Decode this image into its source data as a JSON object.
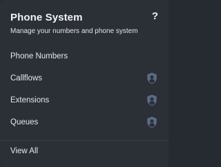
{
  "header": {
    "title": "Phone System",
    "subtitle": "Manage your numbers and phone system",
    "help_label": "?"
  },
  "menu": {
    "items": [
      {
        "label": "Phone Numbers",
        "icon": ""
      },
      {
        "label": "Callflows",
        "icon": "admin-user-shield-icon"
      },
      {
        "label": "Extensions",
        "icon": "admin-user-shield-icon"
      },
      {
        "label": "Queues",
        "icon": "admin-user-shield-icon"
      }
    ]
  },
  "footer": {
    "view_all_label": "View All"
  },
  "colors": {
    "panel_background": "#2b2f36",
    "text": "#e6e8eb",
    "icon_shield": "#5a6a86",
    "icon_user": "#2b2f36",
    "divider": "#3b4048"
  }
}
